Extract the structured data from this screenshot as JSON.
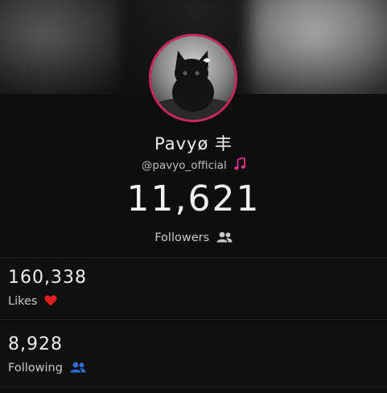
{
  "profile": {
    "name": "Pavyø 丰",
    "handle": "@pavyo_official",
    "handle_icon": "music-note-icon",
    "followers_count": "11,621",
    "followers_label": "Followers",
    "followers_icon": "users-icon"
  },
  "stats": [
    {
      "value": "160,338",
      "label": "Likes",
      "icon": "heart-icon",
      "icon_color": "#e02020"
    },
    {
      "value": "8,928",
      "label": "Following",
      "icon": "users-icon",
      "icon_color": "#2b6fd6"
    }
  ],
  "colors": {
    "background": "#0e0e0f",
    "avatar_ring": "#c9285d",
    "music_icon": "#e0338f",
    "followers_icon": "#c8c8ca"
  }
}
